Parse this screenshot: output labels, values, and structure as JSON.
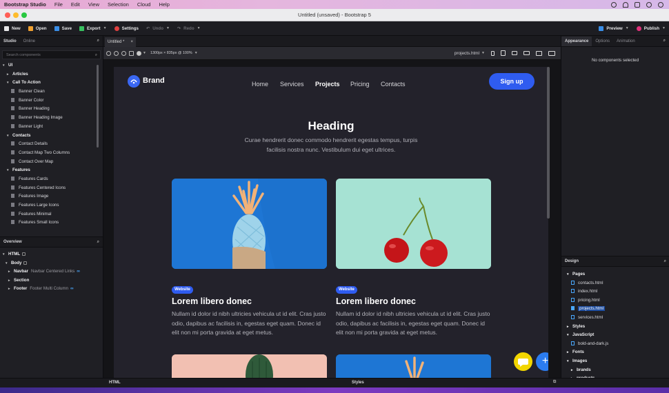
{
  "menubar": {
    "app": "Bootstrap Studio",
    "items": [
      "File",
      "Edit",
      "View",
      "Selection",
      "Cloud",
      "Help"
    ]
  },
  "window": {
    "title": "Untitled (unsaved) - Bootstrap 5"
  },
  "toolbar": {
    "new": "New",
    "open": "Open",
    "save": "Save",
    "export": "Export",
    "settings": "Settings",
    "undo": "Undo",
    "redo": "Redo",
    "preview": "Preview",
    "publish": "Publish"
  },
  "left": {
    "tabs": [
      "Studio",
      "Online"
    ],
    "search_placeholder": "Search components",
    "tree": [
      {
        "label": "UI",
        "level": 0,
        "cat": true,
        "arrow": "▾"
      },
      {
        "label": "Articles",
        "level": 1,
        "cat": true,
        "arrow": "▸"
      },
      {
        "label": "Call To Action",
        "level": 1,
        "cat": true,
        "arrow": "▾"
      },
      {
        "label": "Banner Clean",
        "level": 2
      },
      {
        "label": "Banner Color",
        "level": 2
      },
      {
        "label": "Banner Heading",
        "level": 2
      },
      {
        "label": "Banner Heading Image",
        "level": 2
      },
      {
        "label": "Banner Light",
        "level": 2
      },
      {
        "label": "Contacts",
        "level": 1,
        "cat": true,
        "arrow": "▾"
      },
      {
        "label": "Contact Details",
        "level": 2
      },
      {
        "label": "Contact Map Two Columns",
        "level": 2
      },
      {
        "label": "Contact Over Map",
        "level": 2
      },
      {
        "label": "Features",
        "level": 1,
        "cat": true,
        "arrow": "▾"
      },
      {
        "label": "Features Cards",
        "level": 2
      },
      {
        "label": "Features Centered Icons",
        "level": 2
      },
      {
        "label": "Features Image",
        "level": 2
      },
      {
        "label": "Features Large Icons",
        "level": 2
      },
      {
        "label": "Features Minimal",
        "level": 2
      },
      {
        "label": "Features Small Icons",
        "level": 2
      }
    ],
    "overview_title": "Overview",
    "overview": {
      "html": "HTML",
      "body": "Body",
      "navbar": "Navbar",
      "navbar_sub": "Navbar Centered Links",
      "section": "Section",
      "footer": "Footer",
      "footer_sub": "Footer Multi Column"
    }
  },
  "editor": {
    "tab": "Untitled *",
    "size_label": "1300px × 835px @ 100%",
    "page_select": "projects.html",
    "site": {
      "brand": "Brand",
      "nav": [
        "Home",
        "Services",
        "Projects",
        "Pricing",
        "Contacts"
      ],
      "signup": "Sign up",
      "heading": "Heading",
      "lead": "Curae hendrerit donec commodo hendrerit egestas tempus, turpis facilisis nostra nunc. Vestibulum dui eget ultrices.",
      "cards": [
        {
          "badge": "Website",
          "title": "Lorem libero donec",
          "text": "Nullam id dolor id nibh ultricies vehicula ut id elit. Cras justo odio, dapibus ac facilisis in, egestas eget quam. Donec id elit non mi porta gravida at eget metus."
        },
        {
          "badge": "Website",
          "title": "Lorem libero donec",
          "text": "Nullam id dolor id nibh ultricies vehicula ut id elit. Cras justo odio, dapibus ac facilisis in, egestas eget quam. Donec id elit non mi porta gravida at eget metus."
        }
      ]
    }
  },
  "right": {
    "tabs": [
      "Appearance",
      "Options",
      "Animation"
    ],
    "empty": "No components selected",
    "design_title": "Design",
    "design": {
      "pages": "Pages",
      "page_files": [
        "contacts.html",
        "index.html",
        "pricing.html",
        "projects.html",
        "services.html"
      ],
      "styles": "Styles",
      "javascript": "JavaScript",
      "js_file": "bold-and-dark.js",
      "fonts": "Fonts",
      "images": "Images",
      "brands": "brands",
      "products": "products"
    }
  },
  "bottom": {
    "html": "HTML",
    "styles": "Styles"
  },
  "colors": {
    "accent": "#2f5cf0",
    "chat": "#f2d600",
    "fab": "#2b7cf0"
  }
}
